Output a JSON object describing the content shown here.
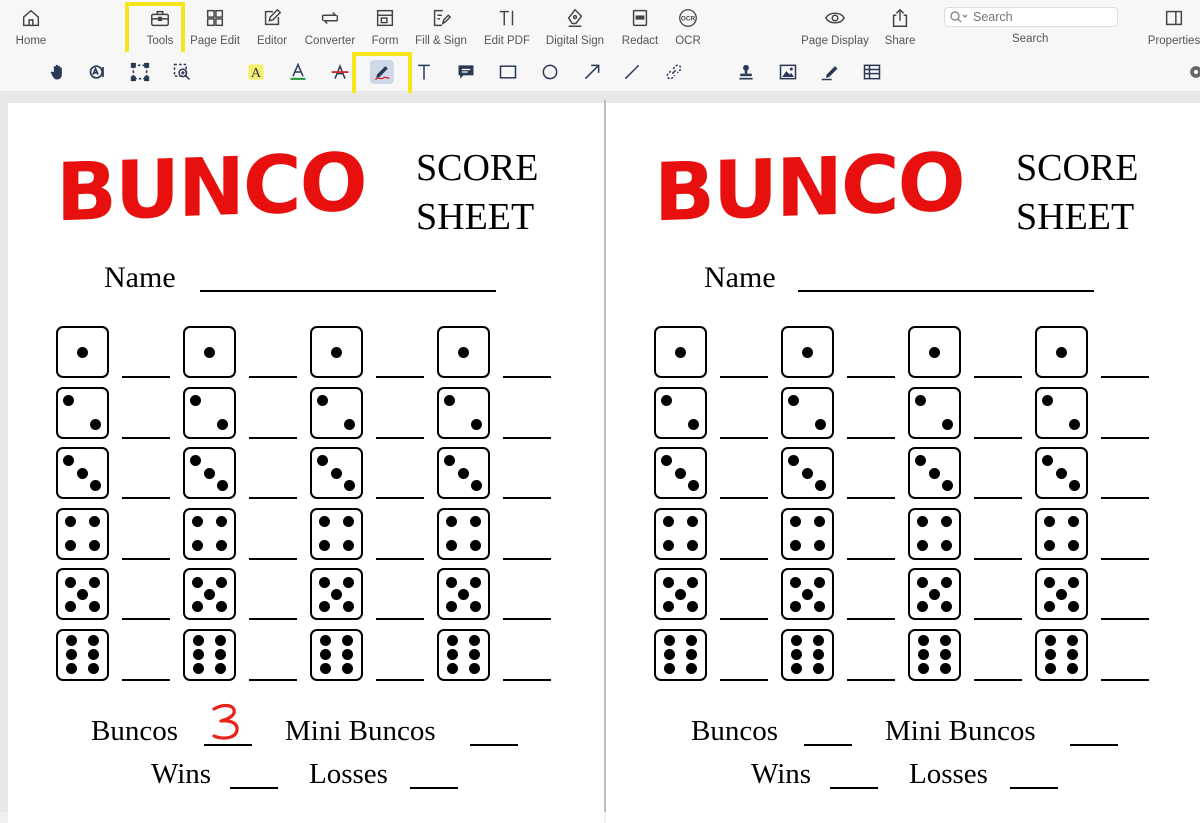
{
  "toolbar": {
    "home": "Home",
    "tools": "Tools",
    "page_edit": "Page Edit",
    "editor": "Editor",
    "converter": "Converter",
    "form": "Form",
    "fill_sign": "Fill & Sign",
    "edit_pdf": "Edit PDF",
    "digital_sign": "Digital Sign",
    "redact": "Redact",
    "ocr": "OCR",
    "page_display": "Page Display",
    "share": "Share",
    "search_placeholder": "Search",
    "search_label": "Search",
    "properties": "Properties"
  },
  "icons": {
    "ocr_badge": "OCR",
    "text_tool_glyph": "T",
    "highlight_glyph": "A"
  },
  "colors": {
    "highlight_box": "#f7e51c",
    "bunco_red": "#e8100e",
    "handwriting_red": "#e8231a"
  },
  "pages": {
    "left": {
      "title": "BUNCO",
      "score_1": "SCORE",
      "score_2": "SHEET",
      "name_label": "Name",
      "buncos_label": "Buncos",
      "buncos_value": "3",
      "mini_buncos_label": "Mini Buncos",
      "wins_label": "Wins",
      "losses_label": "Losses"
    },
    "right": {
      "title": "BUNCO",
      "score_1": "SCORE",
      "score_2": "SHEET",
      "name_label": "Name",
      "buncos_label": "Buncos",
      "mini_buncos_label": "Mini Buncos",
      "wins_label": "Wins",
      "losses_label": "Losses"
    }
  },
  "dice_rows": [
    1,
    2,
    3,
    4,
    5,
    6
  ]
}
